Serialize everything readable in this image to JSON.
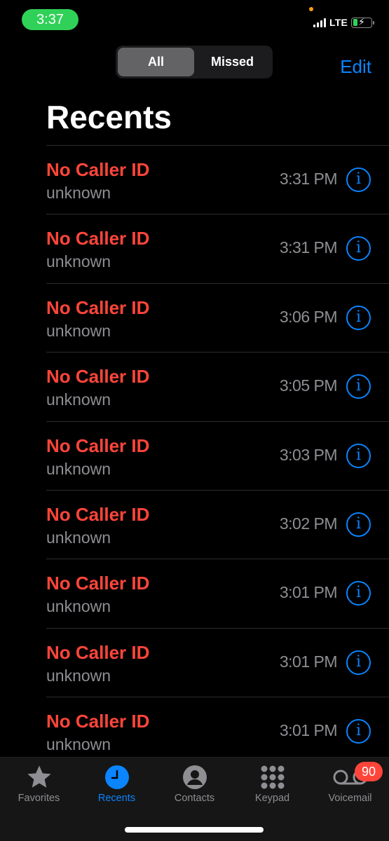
{
  "status_bar": {
    "time": "3:37",
    "network": "LTE",
    "battery_charging": true,
    "signal_bars": 4
  },
  "header": {
    "segments": [
      {
        "label": "All",
        "active": true
      },
      {
        "label": "Missed",
        "active": false
      }
    ],
    "edit_label": "Edit",
    "title": "Recents"
  },
  "calls": [
    {
      "name": "No Caller ID",
      "subtitle": "unknown",
      "time": "3:31 PM"
    },
    {
      "name": "No Caller ID",
      "subtitle": "unknown",
      "time": "3:31 PM"
    },
    {
      "name": "No Caller ID",
      "subtitle": "unknown",
      "time": "3:06 PM"
    },
    {
      "name": "No Caller ID",
      "subtitle": "unknown",
      "time": "3:05 PM"
    },
    {
      "name": "No Caller ID",
      "subtitle": "unknown",
      "time": "3:03 PM"
    },
    {
      "name": "No Caller ID",
      "subtitle": "unknown",
      "time": "3:02 PM"
    },
    {
      "name": "No Caller ID",
      "subtitle": "unknown",
      "time": "3:01 PM"
    },
    {
      "name": "No Caller ID",
      "subtitle": "unknown",
      "time": "3:01 PM"
    },
    {
      "name": "No Caller ID",
      "subtitle": "unknown",
      "time": "3:01 PM"
    }
  ],
  "tab_bar": {
    "tabs": [
      {
        "label": "Favorites",
        "icon": "star-icon",
        "active": false
      },
      {
        "label": "Recents",
        "icon": "clock-icon",
        "active": true
      },
      {
        "label": "Contacts",
        "icon": "person-circle-icon",
        "active": false
      },
      {
        "label": "Keypad",
        "icon": "keypad-icon",
        "active": false
      },
      {
        "label": "Voicemail",
        "icon": "voicemail-icon",
        "active": false,
        "badge": "90"
      }
    ]
  },
  "colors": {
    "accent": "#0a84ff",
    "missed": "#ff453a",
    "status_pill": "#30d158",
    "secondary_text": "#8e8e93"
  }
}
